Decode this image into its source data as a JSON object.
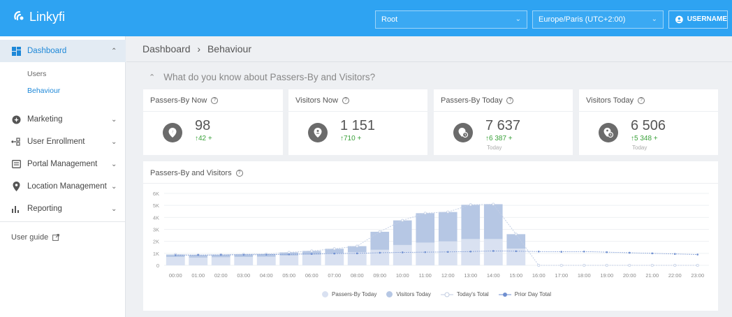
{
  "app": {
    "name": "Linkyfi"
  },
  "topbar": {
    "org_select": "Root",
    "timezone_select": "Europe/Paris (UTC+2:00)",
    "user_label": "USERNAME"
  },
  "sidebar": {
    "dashboard": "Dashboard",
    "sub_users": "Users",
    "sub_behaviour": "Behaviour",
    "marketing": "Marketing",
    "user_enrollment": "User Enrollment",
    "portal_management": "Portal Management",
    "location_management": "Location Management",
    "reporting": "Reporting",
    "user_guide": "User guide"
  },
  "breadcrumb": {
    "root": "Dashboard",
    "sep": "›",
    "current": "Behaviour"
  },
  "section": {
    "title": "What do you know about Passers-By and Visitors?"
  },
  "cards": [
    {
      "title": "Passers-By Now",
      "value": "98",
      "delta": "↑42 +",
      "sub": ""
    },
    {
      "title": "Visitors Now",
      "value": "1 151",
      "delta": "↑710 +",
      "sub": ""
    },
    {
      "title": "Passers-By Today",
      "value": "7 637",
      "delta": "↑6 387 +",
      "sub": "Today"
    },
    {
      "title": "Visitors Today",
      "value": "6 506",
      "delta": "↑5 348 +",
      "sub": "Today"
    }
  ],
  "colors": {
    "brand": "#2ea3f2",
    "passers_bar": "#b6c7e4",
    "visitors_bar": "#d9e1f1",
    "delta_green": "#3aa13a",
    "prior_day_line": "#6f8fd0"
  },
  "chart_data": {
    "type": "bar",
    "title": "Passers-By and Visitors",
    "categories": [
      "00:00",
      "01:00",
      "02:00",
      "03:00",
      "04:00",
      "05:00",
      "06:00",
      "07:00",
      "08:00",
      "09:00",
      "10:00",
      "11:00",
      "12:00",
      "13:00",
      "14:00",
      "15:00",
      "16:00",
      "17:00",
      "18:00",
      "19:00",
      "20:00",
      "21:00",
      "22:00",
      "23:00"
    ],
    "y_tick_labels": [
      "0",
      "1K",
      "2K",
      "3K",
      "4K",
      "5K",
      "6K"
    ],
    "ylim": [
      0,
      6000
    ],
    "series": [
      {
        "name": "Passers-By Today",
        "type": "bar",
        "values": [
          900,
          850,
          880,
          920,
          940,
          1080,
          1200,
          1380,
          1600,
          2800,
          3750,
          4350,
          4450,
          5050,
          5100,
          2600,
          0,
          0,
          0,
          0,
          0,
          0,
          0,
          0
        ]
      },
      {
        "name": "Visitors Today",
        "type": "bar",
        "values": [
          700,
          650,
          680,
          700,
          720,
          820,
          900,
          1000,
          1100,
          1300,
          1700,
          1900,
          2000,
          2200,
          2200,
          1400,
          0,
          0,
          0,
          0,
          0,
          0,
          0,
          0
        ]
      },
      {
        "name": "Today's Total",
        "type": "line",
        "values": [
          900,
          850,
          880,
          920,
          940,
          1080,
          1200,
          1380,
          1600,
          2800,
          3750,
          4350,
          4450,
          5050,
          5100,
          2600,
          0,
          0,
          0,
          0,
          0,
          0,
          0,
          0
        ]
      },
      {
        "name": "Prior Day Total",
        "type": "line",
        "values": [
          850,
          860,
          870,
          880,
          890,
          920,
          950,
          980,
          1000,
          1050,
          1080,
          1100,
          1120,
          1150,
          1200,
          1180,
          1150,
          1130,
          1150,
          1100,
          1050,
          1000,
          950,
          900
        ]
      }
    ],
    "legend": [
      "Passers-By Today",
      "Visitors Today",
      "Today's Total",
      "Prior Day Total"
    ]
  }
}
